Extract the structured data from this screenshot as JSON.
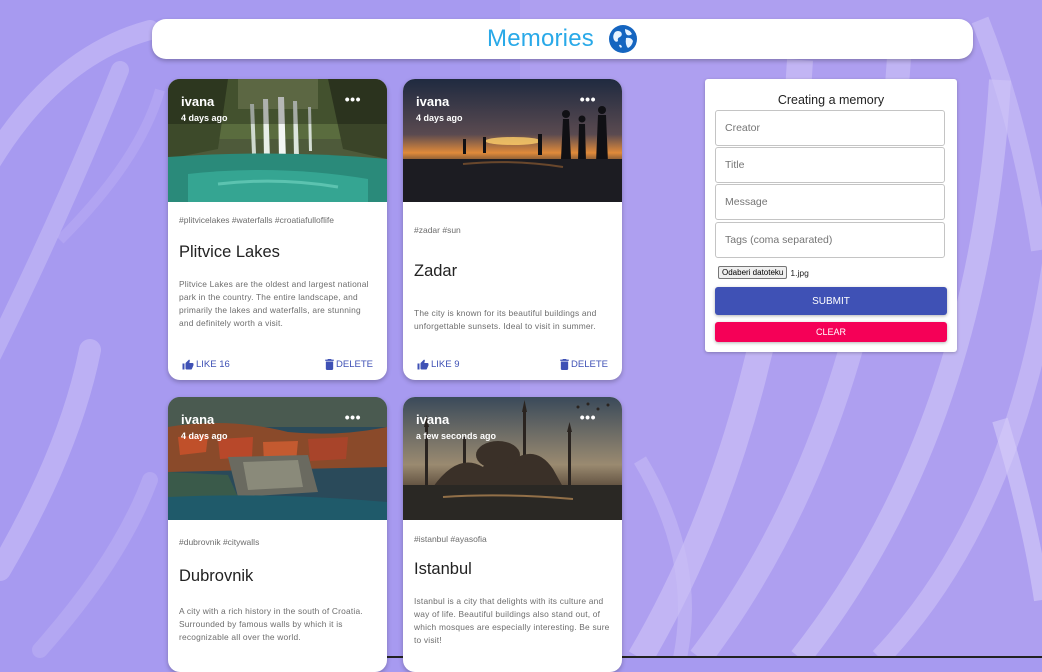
{
  "app": {
    "title": "Memories",
    "icon": "globe-icon"
  },
  "colors": {
    "background": "#a79af0",
    "title": "#29a9e8",
    "primary": "#3f51b5",
    "secondary": "#f50057"
  },
  "posts": [
    {
      "author": "ivana",
      "time": "4 days ago",
      "tags": "#plitvicelakes #waterfalls #croatiafulloflife",
      "title": "Plitvice Lakes",
      "message": "Plitvice Lakes are the oldest and largest national park in the country. The entire landscape, and primarily the lakes and waterfalls, are stunning and definitely worth a visit.",
      "like_label": "LIKE 16",
      "delete_label": "DELETE",
      "more_label": "•••"
    },
    {
      "author": "ivana",
      "time": "4 days ago",
      "tags": "#zadar #sun",
      "title": "Zadar",
      "message": "The city is known for its beautiful buildings and unforgettable sunsets. Ideal to visit in summer.",
      "like_label": "LIKE 9",
      "delete_label": "DELETE",
      "more_label": "•••"
    },
    {
      "author": "ivana",
      "time": "4 days ago",
      "tags": "#dubrovnik #citywalls",
      "title": "Dubrovnik",
      "message": "A city with a rich history in the south of Croatia. Surrounded by famous walls by which it is recognizable all over the world.",
      "more_label": "•••"
    },
    {
      "author": "ivana",
      "time": "a few seconds ago",
      "tags": "#istanbul #ayasofia",
      "title": "Istanbul",
      "message": "Istanbul is a city that delights with its culture and way of life. Beautiful buildings also stand out, of which mosques are especially interesting. Be sure to visit!",
      "more_label": "•••"
    }
  ],
  "form": {
    "title": "Creating a memory",
    "creator_placeholder": "Creator",
    "title_placeholder": "Title",
    "message_placeholder": "Message",
    "tags_placeholder": "Tags (coma separated)",
    "file_button": "Odaberi datoteku",
    "file_name": "1.jpg",
    "submit_label": "SUBMIT",
    "clear_label": "CLEAR"
  }
}
